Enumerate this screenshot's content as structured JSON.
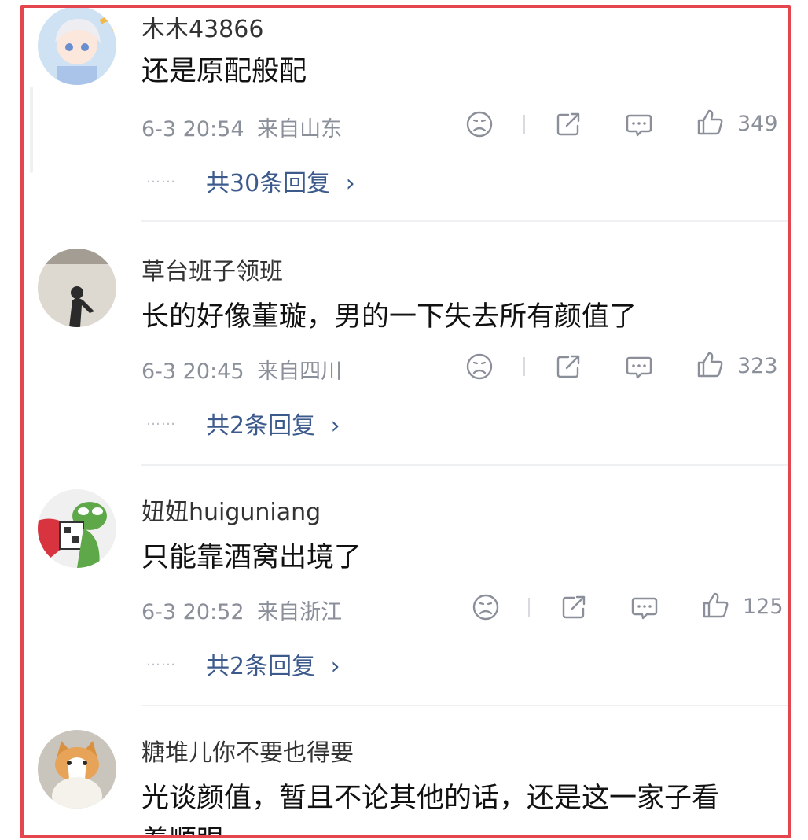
{
  "comments": [
    {
      "username": "木木43866",
      "text": "还是原配般配",
      "time": "6-3 20:54",
      "location": "来自山东",
      "likes": "349",
      "replies": "共30条回复",
      "avatar_icon": "anime-girl-avatar"
    },
    {
      "username": "草台班子领班",
      "text": "长的好像董璇，男的一下失去所有颜值了",
      "time": "6-3 20:45",
      "location": "来自四川",
      "likes": "323",
      "replies": "共2条回复",
      "avatar_icon": "person-silhouette-avatar"
    },
    {
      "username": "妞妞huiguniang",
      "text": "只能靠酒窝出境了",
      "time": "6-3 20:52",
      "location": "来自浙江",
      "likes": "125",
      "replies": "共2条回复",
      "avatar_icon": "frog-avatar"
    },
    {
      "username": "糖堆儿你不要也得要",
      "text": "光谈颜值，暂且不论其他的话，还是这一家子看",
      "text_cut": "着顺眼",
      "avatar_icon": "cat-avatar"
    }
  ],
  "dots": "……",
  "chevron": "›",
  "colors": {
    "frame": "#e5454d",
    "link": "#3c5a8c",
    "meta": "#8a8f99"
  }
}
